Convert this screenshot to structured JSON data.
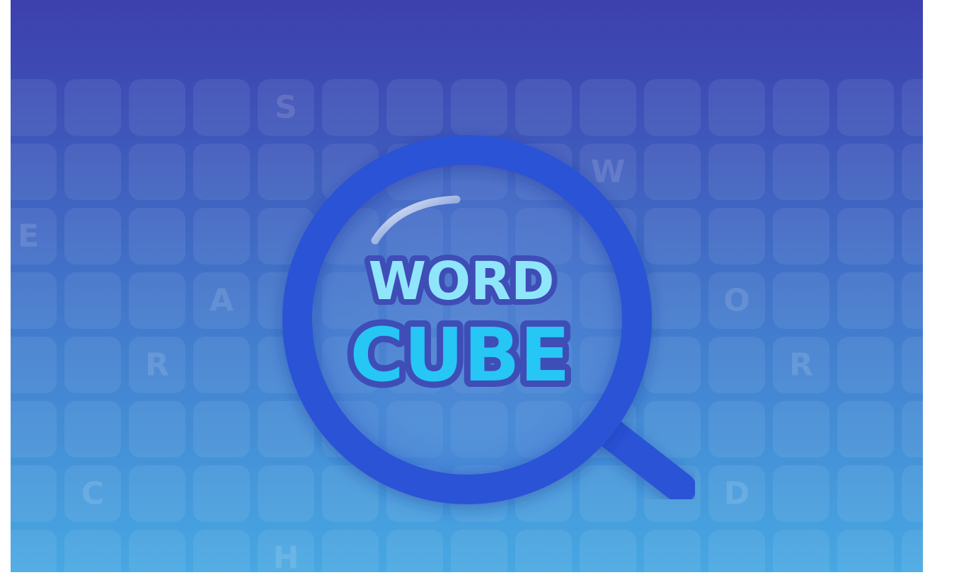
{
  "logo": {
    "word_line": "WORD",
    "cube_line": "CUBE"
  },
  "grid_letters": [
    {
      "letter": "S",
      "row": 0,
      "col": 4
    },
    {
      "letter": "W",
      "row": 1,
      "col": 9
    },
    {
      "letter": "E",
      "row": 2,
      "col": 0
    },
    {
      "letter": "A",
      "row": 3,
      "col": 3
    },
    {
      "letter": "O",
      "row": 3,
      "col": 11
    },
    {
      "letter": "R",
      "row": 4,
      "col": 2
    },
    {
      "letter": "R",
      "row": 4,
      "col": 12
    },
    {
      "letter": "C",
      "row": 6,
      "col": 1
    },
    {
      "letter": "D",
      "row": 6,
      "col": 11
    },
    {
      "letter": "H",
      "row": 7,
      "col": 4
    }
  ],
  "icons": {
    "magnifier": "magnifying-glass-icon"
  },
  "colors": {
    "background_top": "#3d44b0",
    "background_bottom": "#47a8e2",
    "magnifier_ring": "#2a52d6",
    "word_fill": "#8fe6fb",
    "cube_fill": "#26c6f5",
    "title_outline": "#3f4db6"
  }
}
